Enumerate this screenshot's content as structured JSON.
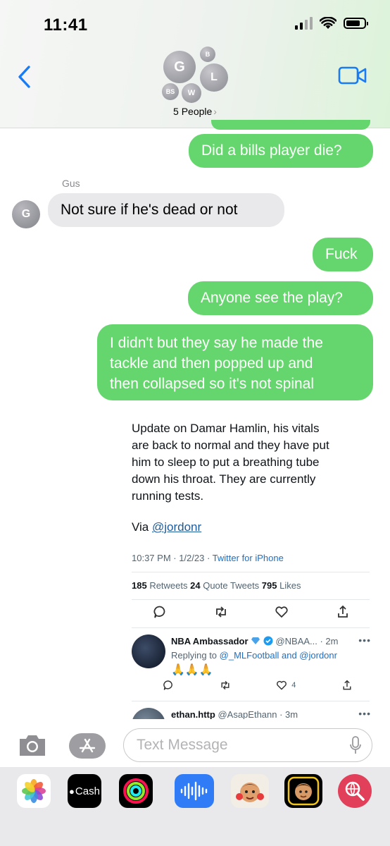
{
  "status_bar": {
    "time": "11:41"
  },
  "header": {
    "avatars": [
      {
        "initials": "G"
      },
      {
        "initials": "B"
      },
      {
        "initials": "L"
      },
      {
        "initials": "BS"
      },
      {
        "initials": "W"
      }
    ],
    "people_label": "5 People",
    "people_chevron": "›"
  },
  "messages": [
    {
      "from": "me",
      "text": "Did a bills player die?"
    },
    {
      "from": "Gus",
      "sender_label": "Gus",
      "avatar_initial": "G",
      "text": "Not sure if he's dead or not"
    },
    {
      "from": "me",
      "text": "Fuck"
    },
    {
      "from": "me",
      "text": "Anyone see the play?"
    },
    {
      "from": "me",
      "lines": [
        "I didn't but they say he made the",
        "tackle and then popped up and",
        "then collapsed so it's not spinal"
      ]
    }
  ],
  "tweet": {
    "lines": [
      "Update on Damar Hamlin, his vitals",
      "are back to normal and they have put",
      "him to sleep to put a breathing tube",
      "down his throat. They are currently",
      "running tests."
    ],
    "via_prefix": "Via ",
    "via_handle": "@jordonr",
    "timestamp": "10:37 PM · 1/2/23 · ",
    "source": "Twitter for iPhone",
    "stats": {
      "retweets_count": "185",
      "retweets_label": " Retweets  ",
      "quotes_count": "24",
      "quotes_label": " Quote Tweets  ",
      "likes_count": "795",
      "likes_label": " Likes"
    },
    "replies": [
      {
        "name": "NBA Ambassador",
        "handle": "@NBAA... · 2m",
        "replying_prefix": "Replying to ",
        "replying_to": "@_MLFootball and @jordonr",
        "text": "🙏🙏🙏",
        "like_count": "4"
      },
      {
        "name": "ethan.http",
        "handle": "@AsapEthann · 3m"
      }
    ]
  },
  "composer": {
    "placeholder": "Text Message"
  },
  "app_drawer": {
    "apps": [
      "photos-app",
      "cash-app",
      "activity-app",
      "audio-app",
      "memoji-app-1",
      "memoji-app-2",
      "search-images-app"
    ],
    "cash_label": "Cash"
  }
}
